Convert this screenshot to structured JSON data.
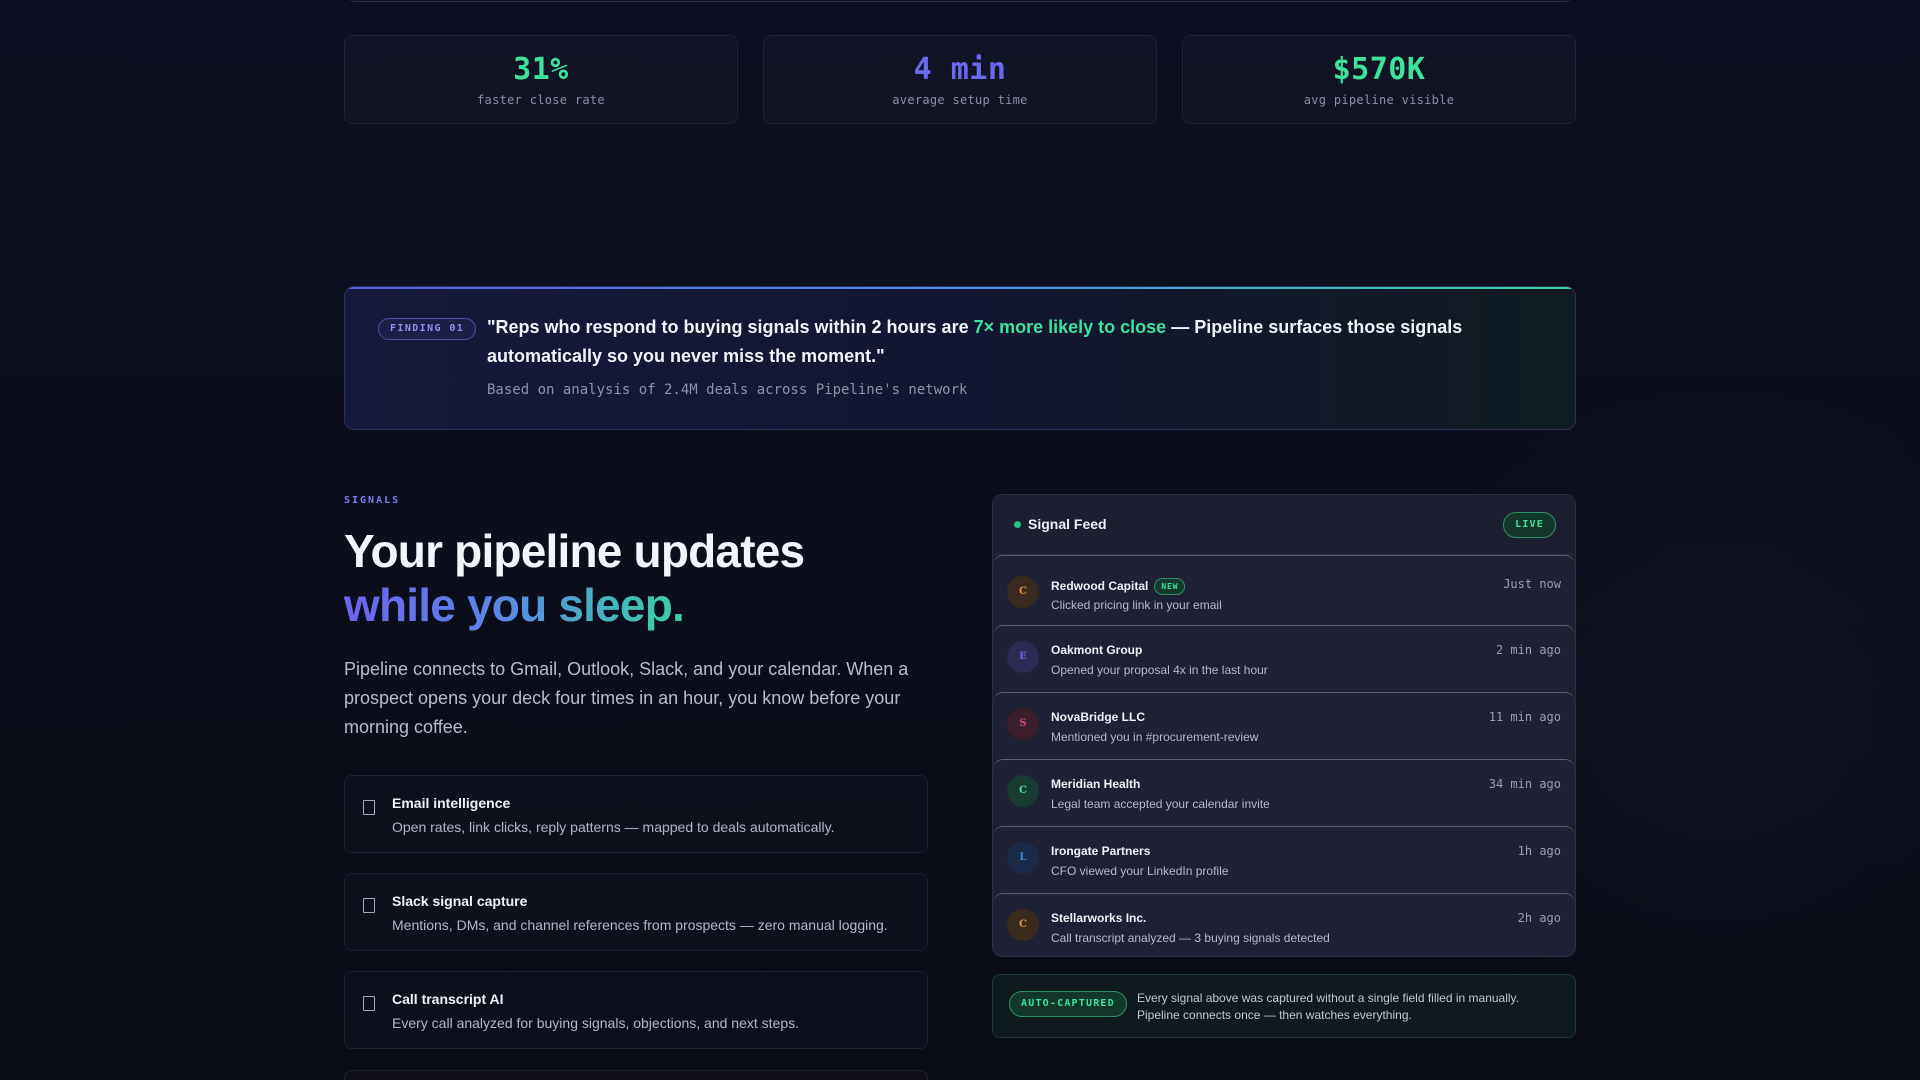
{
  "stats": [
    {
      "value": "31%",
      "label": "faster close rate",
      "color": "#3ee29a"
    },
    {
      "value": "4 min",
      "label": "average setup time",
      "color": "#6b68f0"
    },
    {
      "value": "$570K",
      "label": "avg pipeline visible",
      "color": "#3ee29a"
    }
  ],
  "finding": {
    "badge": "FINDING 01",
    "quote_before": "\"Reps who respond to buying signals within 2 hours are ",
    "quote_highlight": "7× more likely to close",
    "quote_after": " — Pipeline surfaces those signals automatically so you never miss the moment.\"",
    "source": "Based on analysis of 2.4M deals across Pipeline's network"
  },
  "signals": {
    "eyebrow": "SIGNALS",
    "headline_line1": "Your pipeline updates",
    "headline_line2": "while you sleep.",
    "lead": "Pipeline connects to Gmail, Outlook, Slack, and your calendar. When a prospect opens your deck four times in an hour, you know before your morning coffee.",
    "features": [
      {
        "title": "Email intelligence",
        "desc": "Open rates, link clicks, reply patterns — mapped to deals automatically."
      },
      {
        "title": "Slack signal capture",
        "desc": "Mentions, DMs, and channel references from prospects — zero manual logging."
      },
      {
        "title": "Call transcript AI",
        "desc": "Every call analyzed for buying signals, objections, and next steps."
      }
    ]
  },
  "feed": {
    "title": "Signal Feed",
    "live_label": "LIVE",
    "new_label": "NEW",
    "rows": [
      {
        "initial": "C",
        "name": "Redwood Capital",
        "desc": "Clicked pricing link in your email",
        "time": "Just now",
        "fg": "#e0913a",
        "bg": "#3a2a1e"
      },
      {
        "initial": "E",
        "name": "Oakmont Group",
        "desc": "Opened your proposal 4x in the last hour",
        "time": "2 min ago",
        "fg": "#6b68f0",
        "bg": "#2a2a52"
      },
      {
        "initial": "S",
        "name": "NovaBridge LLC",
        "desc": "Mentioned you in #procurement-review",
        "time": "11 min ago",
        "fg": "#d0456e",
        "bg": "#3a1e2c"
      },
      {
        "initial": "C",
        "name": "Meridian Health",
        "desc": "Legal team accepted your calendar invite",
        "time": "34 min ago",
        "fg": "#3ee29a",
        "bg": "#173a31"
      },
      {
        "initial": "L",
        "name": "Irongate Partners",
        "desc": "CFO viewed your LinkedIn profile",
        "time": "1h ago",
        "fg": "#3e7fd8",
        "bg": "#1b2a48"
      },
      {
        "initial": "C",
        "name": "Stellarworks Inc.",
        "desc": "Call transcript analyzed — 3 buying signals detected",
        "time": "2h ago",
        "fg": "#e0913a",
        "bg": "#3a2a1e"
      }
    ]
  },
  "auto": {
    "badge": "AUTO-CAPTURED",
    "text": "Every signal above was captured without a single field filled in manually. Pipeline connects once — then watches everything."
  }
}
